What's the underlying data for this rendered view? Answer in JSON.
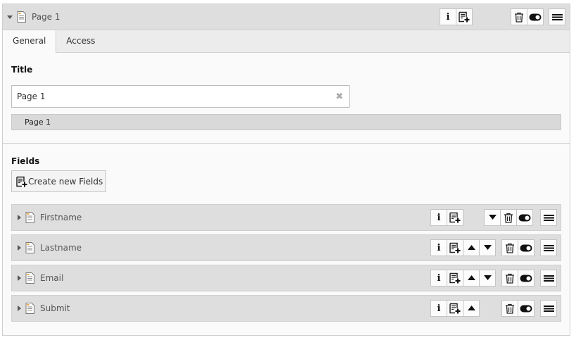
{
  "header": {
    "title": "Page 1"
  },
  "tabs": [
    {
      "label": "General"
    },
    {
      "label": "Access"
    }
  ],
  "title_section": {
    "label": "Title",
    "input_value": "Page 1",
    "clear_glyph": "✖",
    "breadcrumb": "Page 1"
  },
  "fields_section": {
    "label": "Fields",
    "create_label": "Create new Fields"
  },
  "rows": [
    {
      "label": "Firstname"
    },
    {
      "label": "Lastname"
    },
    {
      "label": "Email"
    },
    {
      "label": "Submit"
    }
  ],
  "glyphs": {
    "info": "i"
  },
  "icons": [
    "caret-down-icon",
    "caret-right-icon",
    "page-icon",
    "info-icon",
    "add-record-icon",
    "move-up-icon",
    "move-down-icon",
    "trash-icon",
    "toggle-icon",
    "menu-icon"
  ]
}
